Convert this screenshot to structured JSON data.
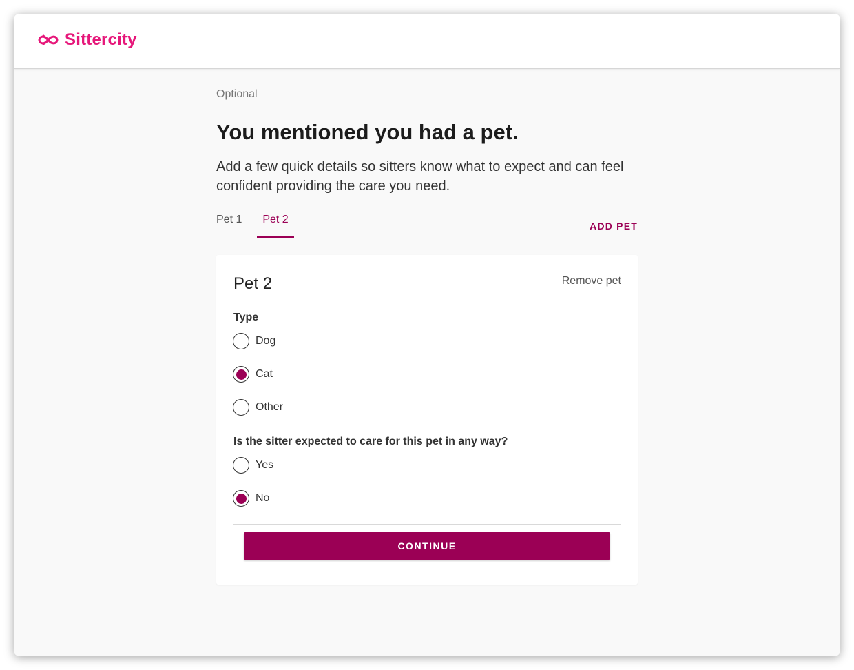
{
  "brand": {
    "name": "Sittercity",
    "icon": "infinity-logo-icon",
    "color": "#e6177a"
  },
  "page": {
    "eyebrow": "Optional",
    "title": "You mentioned you had a pet.",
    "subtitle": "Add a few quick details so sitters know what to expect and can feel confident providing the care you need."
  },
  "tabs": [
    {
      "label": "Pet 1",
      "active": false
    },
    {
      "label": "Pet 2",
      "active": true
    }
  ],
  "add_pet_label": "ADD PET",
  "card": {
    "title": "Pet 2",
    "remove_label": "Remove pet",
    "type_question": "Type",
    "type_options": [
      {
        "label": "Dog",
        "checked": false
      },
      {
        "label": "Cat",
        "checked": true
      },
      {
        "label": "Other",
        "checked": false
      }
    ],
    "care_question": "Is the sitter expected to care for this pet in any way?",
    "care_options": [
      {
        "label": "Yes",
        "checked": false
      },
      {
        "label": "No",
        "checked": true
      }
    ],
    "continue_label": "CONTINUE"
  },
  "colors": {
    "accent": "#9b0055",
    "brand": "#e6177a"
  }
}
